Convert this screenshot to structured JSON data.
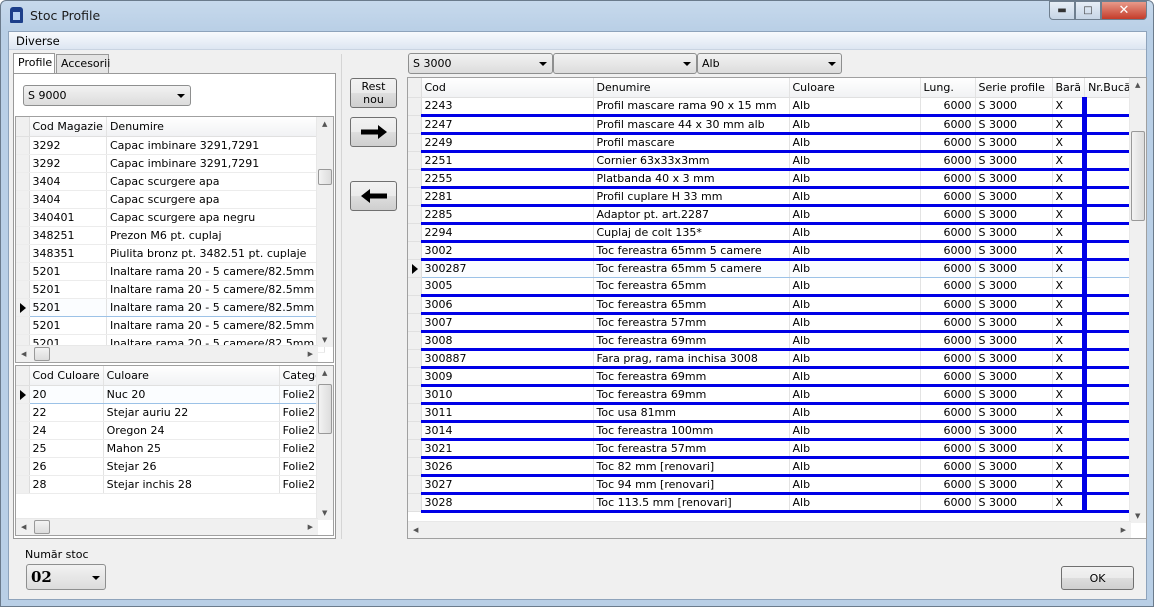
{
  "window": {
    "title": "Stoc Profile",
    "controls": [
      "minimize",
      "maximize",
      "close"
    ]
  },
  "menu": {
    "items": [
      "Diverse"
    ]
  },
  "left_tabs": [
    {
      "label": "Profile",
      "active": true
    },
    {
      "label": "Accesorii",
      "active": false
    }
  ],
  "series_select": {
    "value": "S 9000"
  },
  "products_grid": {
    "columns": [
      "Cod Magazie",
      "Denumire"
    ],
    "rows": [
      [
        "3292",
        "Capac imbinare 3291,7291"
      ],
      [
        "3292",
        "Capac imbinare 3291,7291"
      ],
      [
        "3404",
        "Capac scurgere apa"
      ],
      [
        "3404",
        "Capac scurgere apa"
      ],
      [
        "340401",
        "Capac scurgere apa negru"
      ],
      [
        "348251",
        "Prezon M6 pt. cuplaj"
      ],
      [
        "348351",
        "Piulita bronz pt. 3482.51 pt. cuplaje"
      ],
      [
        "5201",
        "Inaltare rama 20 - 5 camere/82.5mm"
      ],
      [
        "5201",
        "Inaltare rama 20 - 5 camere/82.5mm"
      ],
      [
        "5201",
        "Inaltare rama 20 - 5 camere/82.5mm"
      ],
      [
        "5201",
        "Inaltare rama 20 - 5 camere/82.5mm"
      ],
      [
        "5201",
        "Inaltare rama 20 - 5 camere/82.5mm"
      ]
    ],
    "current_row": 9
  },
  "colors_grid": {
    "columns": [
      "Cod Culoare",
      "Culoare",
      "Categor"
    ],
    "rows": [
      [
        "20",
        "Nuc 20",
        "Folie2"
      ],
      [
        "22",
        "Stejar auriu 22",
        "Folie2"
      ],
      [
        "24",
        "Oregon 24",
        "Folie2"
      ],
      [
        "25",
        "Mahon 25",
        "Folie2"
      ],
      [
        "26",
        "Stejar 26",
        "Folie2"
      ],
      [
        "28",
        "Stejar inchis 28",
        "Folie2"
      ]
    ],
    "current_row": 0
  },
  "middle_buttons": {
    "rest_nou": "Rest nou",
    "add": "right-arrow",
    "remove": "left-arrow"
  },
  "filters": {
    "series": "S 3000",
    "middle": "",
    "color": "Alb"
  },
  "stock_grid": {
    "columns": [
      "Cod",
      "Denumire",
      "Culoare",
      "Lung.",
      "Serie profile",
      "Bară",
      "Nr.Bucăţi"
    ],
    "rows": [
      [
        "2243",
        "Profil mascare rama 90 x 15 mm",
        "Alb",
        "6000",
        "S 3000",
        "X",
        ""
      ],
      [
        "2247",
        "Profil mascare 44 x 30 mm alb",
        "Alb",
        "6000",
        "S 3000",
        "X",
        ""
      ],
      [
        "2249",
        "Profil mascare",
        "Alb",
        "6000",
        "S 3000",
        "X",
        ""
      ],
      [
        "2251",
        "Cornier 63x33x3mm",
        "Alb",
        "6000",
        "S 3000",
        "X",
        ""
      ],
      [
        "2255",
        "Platbanda 40 x 3 mm",
        "Alb",
        "6000",
        "S 3000",
        "X",
        ""
      ],
      [
        "2281",
        "Profil cuplare H 33 mm",
        "Alb",
        "6000",
        "S 3000",
        "X",
        ""
      ],
      [
        "2285",
        "Adaptor pt. art.2287",
        "Alb",
        "6000",
        "S 3000",
        "X",
        ""
      ],
      [
        "2294",
        "Cuplaj de colt 135*",
        "Alb",
        "6000",
        "S 3000",
        "X",
        ""
      ],
      [
        "3002",
        "Toc fereastra 65mm 5 camere",
        "Alb",
        "6000",
        "S 3000",
        "X",
        ""
      ],
      [
        "300287",
        "Toc fereastra 65mm 5 camere",
        "Alb",
        "6000",
        "S 3000",
        "X",
        ""
      ],
      [
        "3005",
        "Toc fereastra 65mm",
        "Alb",
        "6000",
        "S 3000",
        "X",
        ""
      ],
      [
        "3006",
        "Toc fereastra 65mm",
        "Alb",
        "6000",
        "S 3000",
        "X",
        ""
      ],
      [
        "3007",
        "Toc fereastra 57mm",
        "Alb",
        "6000",
        "S 3000",
        "X",
        ""
      ],
      [
        "3008",
        "Toc fereastra 69mm",
        "Alb",
        "6000",
        "S 3000",
        "X",
        ""
      ],
      [
        "300887",
        "Fara prag, rama inchisa 3008",
        "Alb",
        "6000",
        "S 3000",
        "X",
        ""
      ],
      [
        "3009",
        "Toc fereastra 69mm",
        "Alb",
        "6000",
        "S 3000",
        "X",
        ""
      ],
      [
        "3010",
        "Toc fereastra 69mm",
        "Alb",
        "6000",
        "S 3000",
        "X",
        ""
      ],
      [
        "3011",
        "Toc usa 81mm",
        "Alb",
        "6000",
        "S 3000",
        "X",
        ""
      ],
      [
        "3014",
        "Toc fereastra 100mm",
        "Alb",
        "6000",
        "S 3000",
        "X",
        ""
      ],
      [
        "3021",
        "Toc fereastra 57mm",
        "Alb",
        "6000",
        "S 3000",
        "X",
        ""
      ],
      [
        "3026",
        "Toc 82 mm [renovari]",
        "Alb",
        "6000",
        "S 3000",
        "X",
        ""
      ],
      [
        "3027",
        "Toc 94 mm [renovari]",
        "Alb",
        "6000",
        "S 3000",
        "X",
        ""
      ],
      [
        "3028",
        "Toc 113.5 mm [renovari]",
        "Alb",
        "6000",
        "S 3000",
        "X",
        ""
      ]
    ],
    "current_row": 9,
    "highlight_color": "#0000e6"
  },
  "footer": {
    "stock_label": "Număr stoc",
    "stock_value": "02",
    "ok_label": "OK"
  }
}
